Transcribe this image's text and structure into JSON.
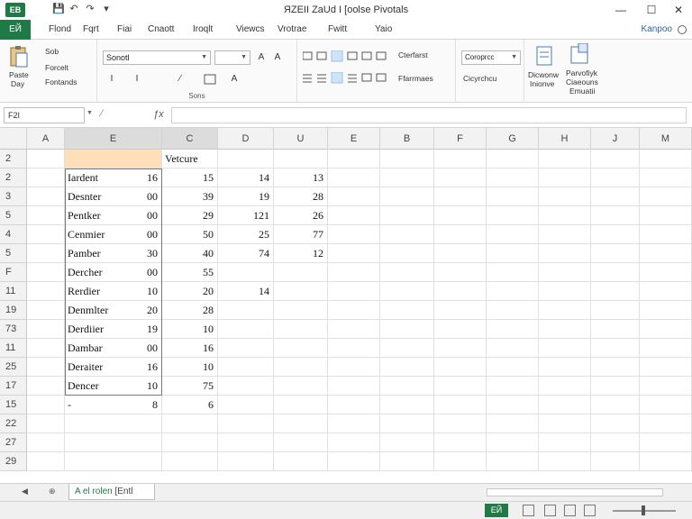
{
  "app": {
    "icon_label": "ЕВ",
    "title": "ЯZEII ZaUd I [oolse Pivotals"
  },
  "quick_access": [
    "💾",
    "↶",
    "↷",
    "▾"
  ],
  "window_controls": {
    "minimize": "—",
    "maximize": "☐",
    "close": "✕"
  },
  "tabs": {
    "file": "ЕЙ",
    "items": [
      "Flond",
      "Fqrt",
      "Fiаi",
      "Cnaott",
      "Iroqlt",
      "Viewcs",
      "Vrotrae",
      "Fwitt",
      "Yaio"
    ],
    "account": "Kanpoo"
  },
  "ribbon": {
    "clipboard": {
      "paste": "Paste",
      "paste_sub": "Day",
      "cut": "Sob",
      "copy": "Forcelt",
      "format": "Fontands"
    },
    "font": {
      "name": "Sonotl",
      "size": "A",
      "bold": "I",
      "italic": "I",
      "underline": "⁄",
      "grow": "A",
      "shrink": "A",
      "group_label": "Sons"
    },
    "alignment": {
      "wrap": "Cterfarst",
      "merge": "Ffarrmaes",
      "group_label": ""
    },
    "number": {
      "format1": "Coroprcc",
      "format2": "Cicyrchcu",
      "group_label": ""
    },
    "styles": {
      "s1": "Dicwonw",
      "s1b": "Inionve",
      "s2": "Parvofiyk",
      "s2b": "Ciaeouns",
      "s2c": "Emuatii"
    }
  },
  "formula_bar": {
    "name_box": "F2I",
    "fx": "ƒx"
  },
  "grid": {
    "columns": [
      "A",
      "E",
      "C",
      "D",
      "U",
      "E",
      "B",
      "F",
      "G",
      "H",
      "J",
      "M"
    ],
    "row_numbers": [
      "2",
      "2",
      "3",
      "5",
      "4",
      "5",
      "F",
      "11",
      "19",
      "73",
      "11",
      "25",
      "17",
      "15",
      "22",
      "27",
      "29"
    ],
    "header_label": "Vetcure",
    "rows": [
      {
        "name": "",
        "b": "",
        "c": "",
        "d": "",
        "e": ""
      },
      {
        "name": "Iardent",
        "b": "16",
        "c": "15",
        "d": "14",
        "e": "13"
      },
      {
        "name": "Desnter",
        "b": "00",
        "c": "39",
        "d": "19",
        "e": "28"
      },
      {
        "name": "Pentker",
        "b": "00",
        "c": "29",
        "d": "121",
        "e": "26"
      },
      {
        "name": "Cenmier",
        "b": "00",
        "c": "50",
        "d": "25",
        "e": "77"
      },
      {
        "name": "Pamber",
        "b": "30",
        "c": "40",
        "d": "74",
        "e": "12"
      },
      {
        "name": "Dercher",
        "b": "00",
        "c": "55",
        "d": "",
        "e": ""
      },
      {
        "name": "Rerdier",
        "b": "10",
        "c": "20",
        "d": "14",
        "e": ""
      },
      {
        "name": "Denmlter",
        "b": "20",
        "c": "28",
        "d": "",
        "e": ""
      },
      {
        "name": "Derdiier",
        "b": "19",
        "c": "10",
        "d": "",
        "e": ""
      },
      {
        "name": "Dambar",
        "b": "00",
        "c": "16",
        "d": "",
        "e": ""
      },
      {
        "name": "Deraiter",
        "b": "16",
        "c": "10",
        "d": "",
        "e": ""
      },
      {
        "name": "Dencer",
        "b": "10",
        "c": "75",
        "d": "",
        "e": ""
      },
      {
        "name": "-",
        "b": "8",
        "c": "6",
        "d": "",
        "e": ""
      },
      {
        "name": "",
        "b": "",
        "c": "",
        "d": "",
        "e": ""
      },
      {
        "name": "",
        "b": "",
        "c": "",
        "d": "",
        "e": ""
      },
      {
        "name": "",
        "b": "",
        "c": "",
        "d": "",
        "e": ""
      }
    ]
  },
  "sheet_tabs": {
    "nav_prev": "◀",
    "nav_next": "⊕",
    "active": "A el rolen",
    "extra": "[Entl"
  },
  "status": {
    "mode": "ЕЙ"
  },
  "colors": {
    "accent": "#1f7a45",
    "header_fill": "#fde0b8"
  }
}
